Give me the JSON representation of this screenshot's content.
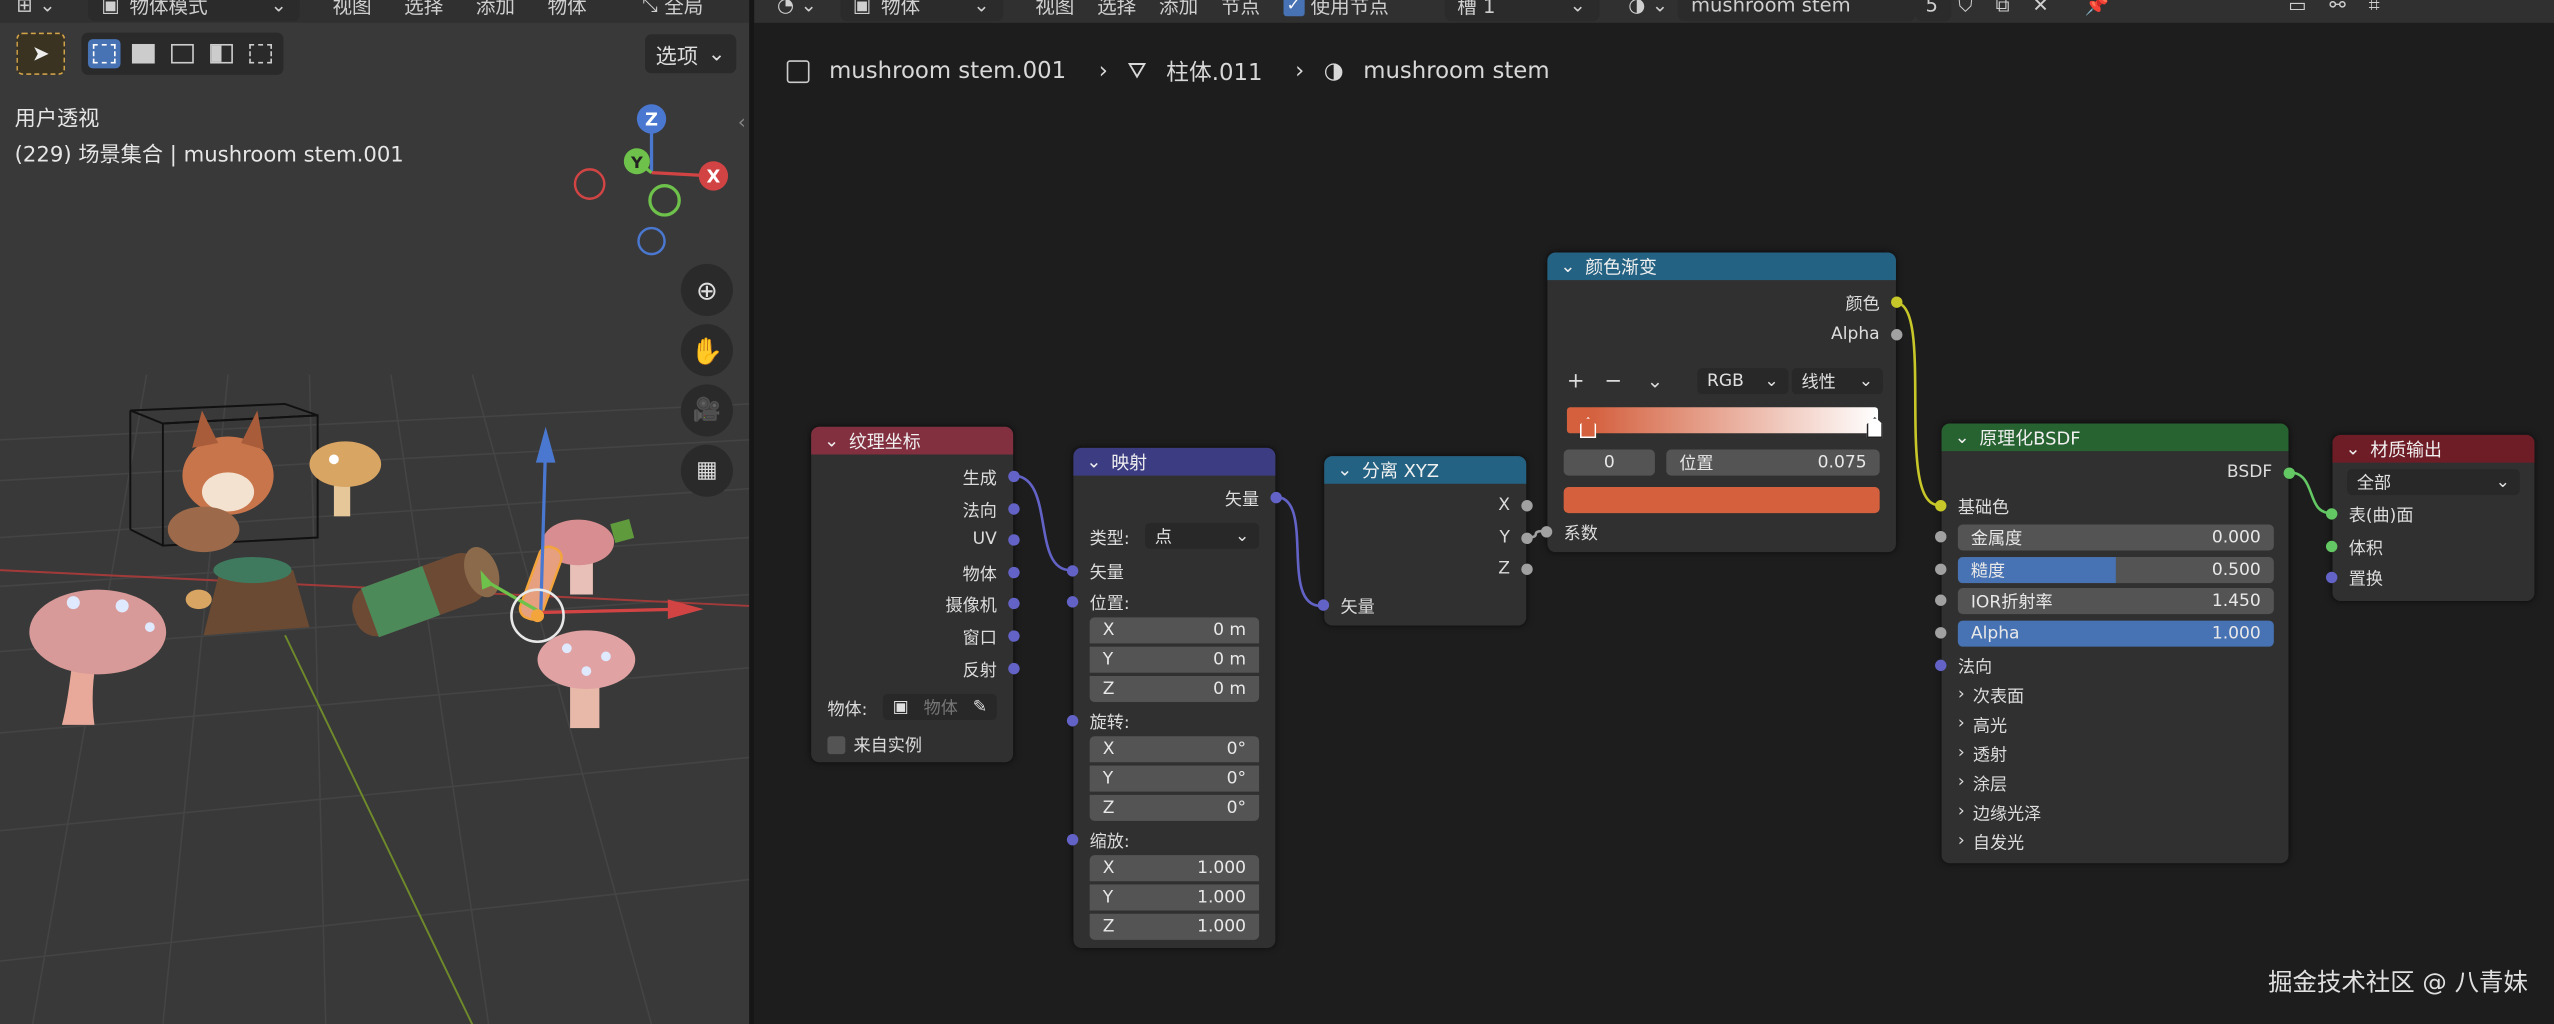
{
  "viewport": {
    "header": {
      "mode": "物体模式",
      "menus": [
        "视图",
        "选择",
        "添加",
        "物体"
      ],
      "global": "全局"
    },
    "options": "选项",
    "info_view": "用户透视",
    "info_scene": "(229) 场景集合 | mushroom stem.001",
    "gizmo": {
      "x": "X",
      "y": "Y",
      "z": "Z"
    }
  },
  "editor": {
    "header": {
      "type": "物体",
      "menus": [
        "视图",
        "选择",
        "添加",
        "节点"
      ],
      "use_nodes": "使用节点",
      "slot": "槽 1",
      "material": "mushroom stem",
      "users": "5"
    },
    "breadcrumb": [
      "mushroom stem.001",
      "柱体.011",
      "mushroom stem"
    ]
  },
  "nodes": {
    "texcoord": {
      "title": "纹理坐标",
      "outputs": [
        "生成",
        "法向",
        "UV",
        "物体",
        "摄像机",
        "窗口",
        "反射"
      ],
      "object_label": "物体:",
      "object_placeholder": "物体",
      "from_instance": "来自实例"
    },
    "mapping": {
      "title": "映射",
      "output": "矢量",
      "type_label": "类型:",
      "type_value": "点",
      "vector_in": "矢量",
      "location": "位置:",
      "loc": [
        {
          "k": "X",
          "v": "0 m"
        },
        {
          "k": "Y",
          "v": "0 m"
        },
        {
          "k": "Z",
          "v": "0 m"
        }
      ],
      "rotation": "旋转:",
      "rot": [
        {
          "k": "X",
          "v": "0°"
        },
        {
          "k": "Y",
          "v": "0°"
        },
        {
          "k": "Z",
          "v": "0°"
        }
      ],
      "scale": "缩放:",
      "scl": [
        {
          "k": "X",
          "v": "1.000"
        },
        {
          "k": "Y",
          "v": "1.000"
        },
        {
          "k": "Z",
          "v": "1.000"
        }
      ]
    },
    "separate": {
      "title": "分离 XYZ",
      "outputs": [
        "X",
        "Y",
        "Z"
      ],
      "input": "矢量"
    },
    "ramp": {
      "title": "颜色渐变",
      "outputs": [
        "颜色",
        "Alpha"
      ],
      "mode": "RGB",
      "interp": "线性",
      "index": "0",
      "pos_label": "位置",
      "pos_value": "0.075",
      "input": "系数",
      "color": "#d4603e"
    },
    "bsdf": {
      "title": "原理化BSDF",
      "output": "BSDF",
      "base_color": "基础色",
      "fields": [
        {
          "k": "金属度",
          "v": "0.000"
        },
        {
          "k": "糙度",
          "v": "0.500"
        },
        {
          "k": "IOR折射率",
          "v": "1.450"
        },
        {
          "k": "Alpha",
          "v": "1.000"
        }
      ],
      "roughness_fill": 0.5,
      "normal": "法向",
      "panels": [
        "次表面",
        "高光",
        "透射",
        "涂层",
        "边缘光泽",
        "自发光"
      ]
    },
    "output": {
      "title": "材质输出",
      "target": "全部",
      "inputs": [
        "表(曲)面",
        "体积",
        "置换"
      ]
    }
  },
  "watermark": "掘金技术社区 @ 八青妹",
  "colors": {
    "texcoord": "#823040",
    "mapping": "#3c3c83",
    "separate": "#246283",
    "ramp": "#246283",
    "bsdf": "#276231",
    "output": "#6e1d26",
    "sock_vec": "#6363c7",
    "sock_col": "#c7c729",
    "sock_float": "#a1a1a1",
    "sock_shader": "#63c763",
    "accent": "#4772b3"
  }
}
